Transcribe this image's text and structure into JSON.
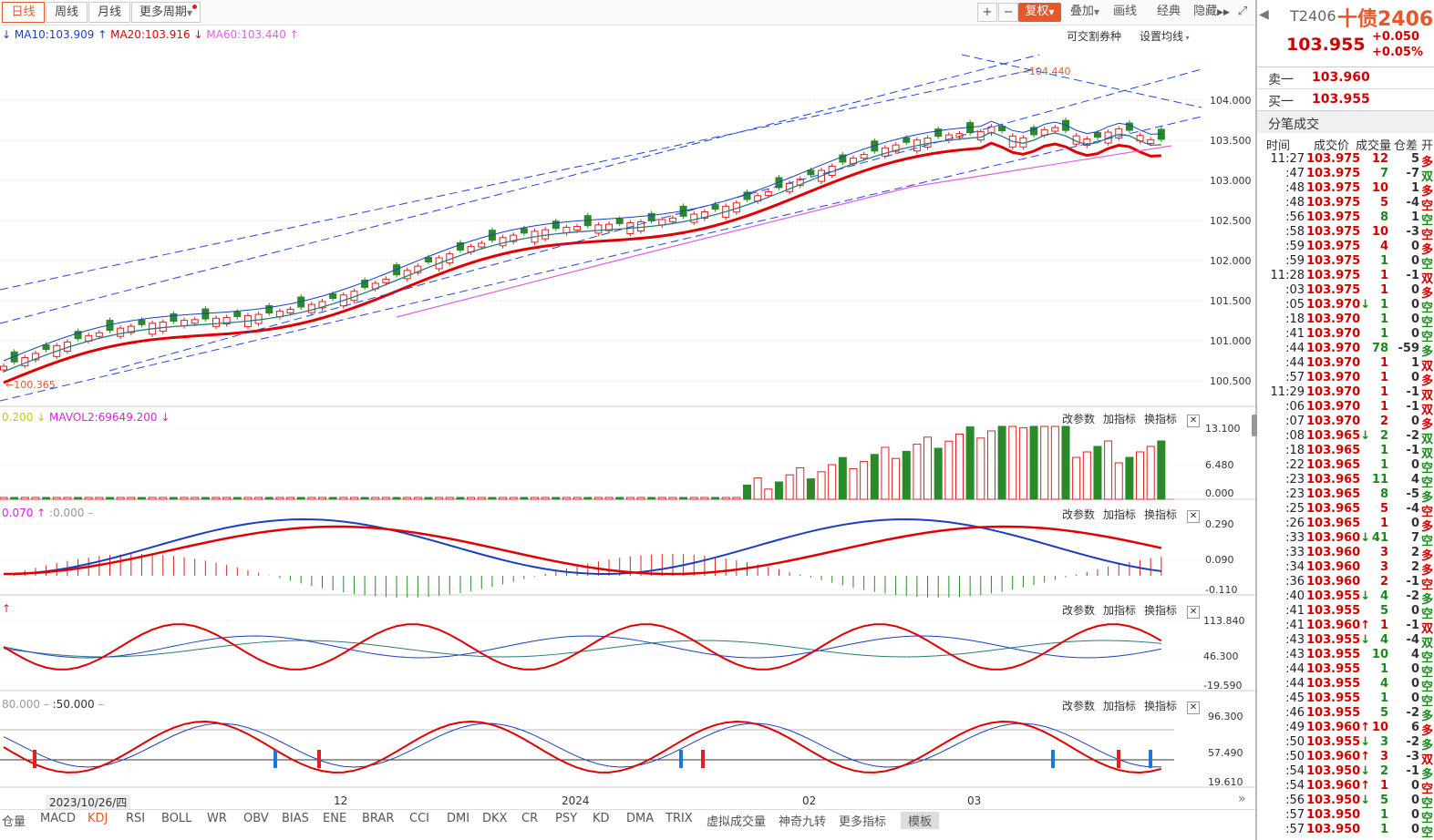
{
  "toolbar": {
    "periods": [
      "日线",
      "周线",
      "月线",
      "更多周期"
    ],
    "right_buttons": [
      "复权",
      "叠加",
      "画线",
      "经典",
      "隐藏"
    ],
    "zoom_in": "+",
    "zoom_out": "−"
  },
  "ma_legend": {
    "ma10": "MA10:103.909",
    "ma20": "MA20:103.916",
    "ma60": "MA60:103.440"
  },
  "main_chart": {
    "labels": {
      "tradable": "可交割券种",
      "setma": "设置均线"
    },
    "y_ticks": [
      "104.000",
      "103.500",
      "103.000",
      "102.500",
      "102.000",
      "101.500",
      "101.000",
      "100.500"
    ],
    "high_label": "104.440",
    "low_label": "100.365"
  },
  "vol_panel": {
    "legend_a": "0.200",
    "legend_b": "MAVOL2:69649.200",
    "y_ticks": [
      "13.100",
      "6.480",
      "0.000"
    ]
  },
  "macd_panel": {
    "legend_a": "0.070",
    "legend_b": ":0.000",
    "y_ticks": [
      "0.290",
      "0.090",
      "-0.110"
    ]
  },
  "panel3": {
    "y_ticks": [
      "113.840",
      "46.300",
      "-19.590"
    ]
  },
  "kdj_panel": {
    "legend_a": "80.000",
    "legend_b": ":50.000",
    "y_ticks": [
      "96.300",
      "57.490",
      "19.610"
    ]
  },
  "panel_buttons": {
    "edit": "改参数",
    "add": "加指标",
    "swap": "换指标",
    "close": "✕"
  },
  "x_axis": {
    "date": "2023/10/26/四",
    "m12": "12",
    "y2024": "2024",
    "m02": "02",
    "m03": "03"
  },
  "bottom_tabs": [
    "仓量",
    "MACD",
    "KDJ",
    "RSI",
    "BOLL",
    "WR",
    "OBV",
    "BIAS",
    "ENE",
    "BRAR",
    "CCI",
    "DMI",
    "DKX",
    "CR",
    "PSY",
    "KD",
    "DMA",
    "TRIX",
    "虚拟成交量",
    "神奇九转",
    "更多指标",
    "模板"
  ],
  "right_panel": {
    "code": "T2406",
    "name": "十债2406",
    "price": "103.955",
    "change": "+0.050",
    "pct": "+0.05%",
    "sell_label": "卖一",
    "sell_price": "103.960",
    "buy_label": "买一",
    "buy_price": "103.955",
    "ticks_title": "分笔成交",
    "col_time": "时间",
    "col_price": "成交价",
    "col_vol": "成交量",
    "col_oi": "仓差",
    "col_k": "开",
    "rows": [
      {
        "t": "11:27",
        "p": "103.975",
        "a": "",
        "v": "12",
        "d": "5",
        "k": "多",
        "kc": "red"
      },
      {
        "t": ":47",
        "p": "103.975",
        "a": "",
        "v": "7",
        "d": "-7",
        "k": "双",
        "kc": "green"
      },
      {
        "t": ":48",
        "p": "103.975",
        "a": "",
        "v": "10",
        "d": "1",
        "k": "多",
        "kc": "red"
      },
      {
        "t": ":48",
        "p": "103.975",
        "a": "",
        "v": "5",
        "d": "-4",
        "k": "空",
        "kc": "red"
      },
      {
        "t": ":56",
        "p": "103.975",
        "a": "",
        "v": "8",
        "d": "1",
        "k": "空",
        "kc": "green"
      },
      {
        "t": ":58",
        "p": "103.975",
        "a": "",
        "v": "10",
        "d": "-3",
        "k": "空",
        "kc": "red"
      },
      {
        "t": ":59",
        "p": "103.975",
        "a": "",
        "v": "4",
        "d": "0",
        "k": "多",
        "kc": "red"
      },
      {
        "t": ":59",
        "p": "103.975",
        "a": "",
        "v": "1",
        "d": "0",
        "k": "空",
        "kc": "green"
      },
      {
        "t": "11:28",
        "p": "103.975",
        "a": "",
        "v": "1",
        "d": "-1",
        "k": "双",
        "kc": "red"
      },
      {
        "t": ":03",
        "p": "103.975",
        "a": "",
        "v": "1",
        "d": "0",
        "k": "多",
        "kc": "red"
      },
      {
        "t": ":05",
        "p": "103.970",
        "a": "↓",
        "v": "1",
        "d": "0",
        "k": "空",
        "kc": "green"
      },
      {
        "t": ":18",
        "p": "103.970",
        "a": "",
        "v": "1",
        "d": "0",
        "k": "空",
        "kc": "green"
      },
      {
        "t": ":41",
        "p": "103.970",
        "a": "",
        "v": "1",
        "d": "0",
        "k": "空",
        "kc": "green"
      },
      {
        "t": ":44",
        "p": "103.970",
        "a": "",
        "v": "78",
        "d": "-59",
        "k": "多",
        "kc": "green"
      },
      {
        "t": ":44",
        "p": "103.970",
        "a": "",
        "v": "1",
        "d": "1",
        "k": "双",
        "kc": "red"
      },
      {
        "t": ":57",
        "p": "103.970",
        "a": "",
        "v": "1",
        "d": "0",
        "k": "多",
        "kc": "red"
      },
      {
        "t": "11:29",
        "p": "103.970",
        "a": "",
        "v": "1",
        "d": "-1",
        "k": "双",
        "kc": "red"
      },
      {
        "t": ":06",
        "p": "103.970",
        "a": "",
        "v": "1",
        "d": "-1",
        "k": "双",
        "kc": "red"
      },
      {
        "t": ":07",
        "p": "103.970",
        "a": "",
        "v": "2",
        "d": "0",
        "k": "多",
        "kc": "red"
      },
      {
        "t": ":08",
        "p": "103.965",
        "a": "↓",
        "v": "2",
        "d": "-2",
        "k": "双",
        "kc": "green"
      },
      {
        "t": ":18",
        "p": "103.965",
        "a": "",
        "v": "1",
        "d": "-1",
        "k": "双",
        "kc": "green"
      },
      {
        "t": ":22",
        "p": "103.965",
        "a": "",
        "v": "1",
        "d": "0",
        "k": "空",
        "kc": "green"
      },
      {
        "t": ":23",
        "p": "103.965",
        "a": "",
        "v": "11",
        "d": "4",
        "k": "空",
        "kc": "green"
      },
      {
        "t": ":23",
        "p": "103.965",
        "a": "",
        "v": "8",
        "d": "-5",
        "k": "多",
        "kc": "green"
      },
      {
        "t": ":25",
        "p": "103.965",
        "a": "",
        "v": "5",
        "d": "-4",
        "k": "空",
        "kc": "red"
      },
      {
        "t": ":26",
        "p": "103.965",
        "a": "",
        "v": "1",
        "d": "0",
        "k": "多",
        "kc": "red"
      },
      {
        "t": ":33",
        "p": "103.960",
        "a": "↓",
        "v": "41",
        "d": "7",
        "k": "空",
        "kc": "green"
      },
      {
        "t": ":33",
        "p": "103.960",
        "a": "",
        "v": "3",
        "d": "2",
        "k": "多",
        "kc": "red"
      },
      {
        "t": ":34",
        "p": "103.960",
        "a": "",
        "v": "3",
        "d": "2",
        "k": "多",
        "kc": "red"
      },
      {
        "t": ":36",
        "p": "103.960",
        "a": "",
        "v": "2",
        "d": "-1",
        "k": "空",
        "kc": "red"
      },
      {
        "t": ":40",
        "p": "103.955",
        "a": "↓",
        "v": "4",
        "d": "-2",
        "k": "多",
        "kc": "green"
      },
      {
        "t": ":41",
        "p": "103.955",
        "a": "",
        "v": "5",
        "d": "0",
        "k": "空",
        "kc": "green"
      },
      {
        "t": ":41",
        "p": "103.960",
        "a": "↑",
        "v": "1",
        "d": "-1",
        "k": "双",
        "kc": "red"
      },
      {
        "t": ":43",
        "p": "103.955",
        "a": "↓",
        "v": "4",
        "d": "-4",
        "k": "双",
        "kc": "green"
      },
      {
        "t": ":43",
        "p": "103.955",
        "a": "",
        "v": "10",
        "d": "4",
        "k": "空",
        "kc": "green"
      },
      {
        "t": ":44",
        "p": "103.955",
        "a": "",
        "v": "1",
        "d": "0",
        "k": "空",
        "kc": "green"
      },
      {
        "t": ":44",
        "p": "103.955",
        "a": "",
        "v": "4",
        "d": "0",
        "k": "空",
        "kc": "green"
      },
      {
        "t": ":45",
        "p": "103.955",
        "a": "",
        "v": "1",
        "d": "0",
        "k": "空",
        "kc": "green"
      },
      {
        "t": ":46",
        "p": "103.955",
        "a": "",
        "v": "5",
        "d": "-2",
        "k": "多",
        "kc": "green"
      },
      {
        "t": ":49",
        "p": "103.960",
        "a": "↑",
        "v": "10",
        "d": "6",
        "k": "多",
        "kc": "red"
      },
      {
        "t": ":50",
        "p": "103.955",
        "a": "↓",
        "v": "3",
        "d": "-2",
        "k": "多",
        "kc": "green"
      },
      {
        "t": ":50",
        "p": "103.960",
        "a": "↑",
        "v": "3",
        "d": "-3",
        "k": "双",
        "kc": "red"
      },
      {
        "t": ":54",
        "p": "103.950",
        "a": "↓",
        "v": "2",
        "d": "-1",
        "k": "多",
        "kc": "green"
      },
      {
        "t": ":54",
        "p": "103.960",
        "a": "↑",
        "v": "1",
        "d": "0",
        "k": "空",
        "kc": "red"
      },
      {
        "t": ":56",
        "p": "103.950",
        "a": "↓",
        "v": "5",
        "d": "0",
        "k": "空",
        "kc": "green"
      },
      {
        "t": ":57",
        "p": "103.950",
        "a": "",
        "v": "1",
        "d": "0",
        "k": "空",
        "kc": "green"
      },
      {
        "t": ":57",
        "p": "103.950",
        "a": "",
        "v": "1",
        "d": "0",
        "k": "空",
        "kc": "green"
      }
    ]
  },
  "colors": {
    "up": "#e02020",
    "down": "#2a8a2a",
    "accent": "#e8572c",
    "ma20": "#e00000",
    "ma10": "#1a3fbf",
    "ma60": "#e060e0"
  }
}
